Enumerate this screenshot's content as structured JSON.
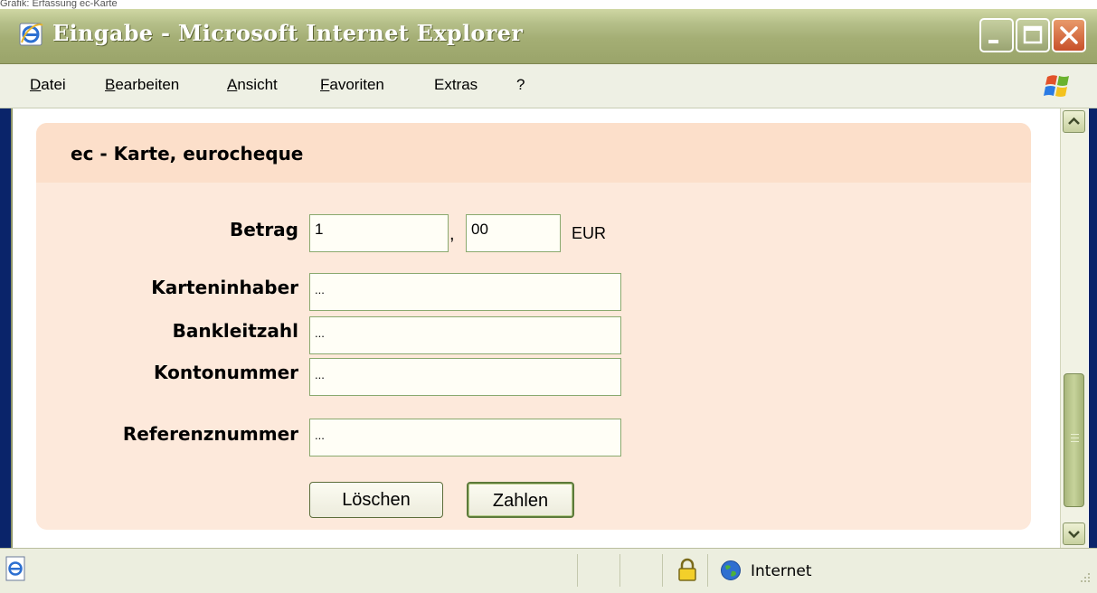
{
  "caption": "Grafik: Erfassung ec-Karte",
  "window": {
    "title": "Eingabe - Microsoft Internet Explorer",
    "colors": {
      "titlebar": "#a4ae74",
      "close_button": "#c8502a"
    }
  },
  "menu": {
    "items": [
      {
        "label": "Datei"
      },
      {
        "label": "Bearbeiten"
      },
      {
        "label": "Ansicht"
      },
      {
        "label": "Favoriten"
      },
      {
        "label": "Extras"
      },
      {
        "label": "?"
      }
    ]
  },
  "form": {
    "title": "ec - Karte, eurocheque",
    "amount": {
      "label": "Betrag",
      "euros": "1",
      "separator": ",",
      "cents": "00",
      "currency": "EUR"
    },
    "cardholder": {
      "label": "Karteninhaber",
      "value": "..."
    },
    "bank_code": {
      "label": "Bankleitzahl",
      "value": "..."
    },
    "account_number": {
      "label": "Kontonummer",
      "value": "..."
    },
    "reference_number": {
      "label": "Referenznummer",
      "value": "..."
    },
    "buttons": {
      "clear": "Löschen",
      "pay": "Zahlen"
    },
    "colors": {
      "panel": "#fde9db",
      "panel_header": "#fcdfca",
      "input_border": "#8aa96e"
    }
  },
  "status": {
    "zone": "Internet",
    "icons": [
      "ie-page-icon",
      "lock-icon",
      "globe-icon"
    ]
  }
}
